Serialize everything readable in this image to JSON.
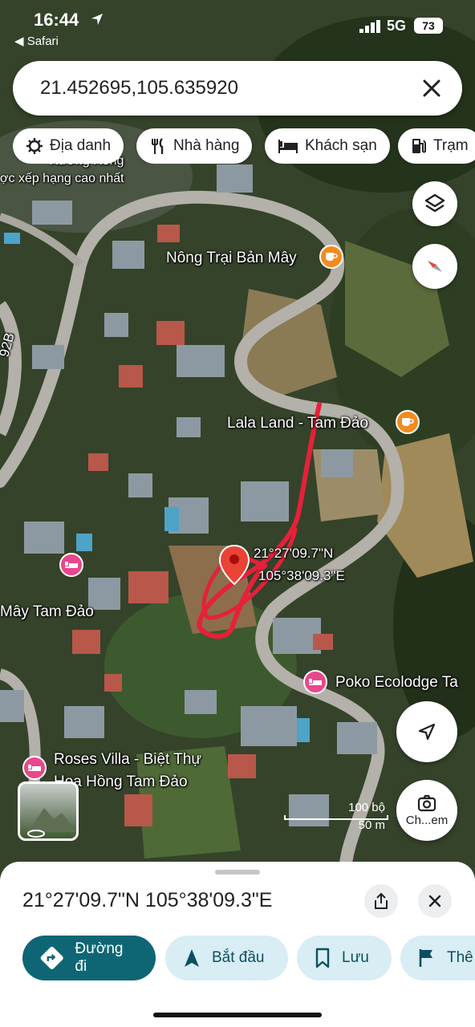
{
  "status_bar": {
    "time": "16:44",
    "back_label": "◀ Safari",
    "network": "5G",
    "battery": "73"
  },
  "search": {
    "value": "21.452695,105.635920"
  },
  "chips": [
    {
      "label": "Địa danh",
      "icon": "landmark-icon"
    },
    {
      "label": "Nhà hàng",
      "icon": "fork-knife-icon"
    },
    {
      "label": "Khách sạn",
      "icon": "bed-icon"
    },
    {
      "label": "Trạm",
      "icon": "gas-station-icon"
    }
  ],
  "map": {
    "labels": {
      "top_cut": "ợc xếp hạng cao nhất",
      "top_cut2": "Xương Rồng",
      "road": "92B",
      "nong_trai": "Nông Trại Bản Mây",
      "lala": "Lala Land - Tam Đảo",
      "pin_lat": "21°27'09.7\"N",
      "pin_lng": "105°38'09.3\"E",
      "may_tam_dao": "Mây Tam Đảo",
      "poko": "Poko Ecolodge Ta",
      "roses_1": "Roses Villa - Biệt Thự",
      "roses_2": "Hoa Hồng Tam Đảo"
    },
    "scale": {
      "imperial": "100 bộ",
      "metric": "50 m"
    },
    "contribute_label": "Ch...em",
    "colors": {
      "pin": "#ea4335",
      "marker_scribble": "#e5213a",
      "cafe_pin": "#f28b20",
      "hotel_pin": "#e8478b"
    }
  },
  "sheet": {
    "coords": "21°27'09.7\"N 105°38'09.3\"E",
    "actions": [
      {
        "label": "Đường đi",
        "icon": "directions-icon"
      },
      {
        "label": "Bắt đầu",
        "icon": "navigation-arrow-icon"
      },
      {
        "label": "Lưu",
        "icon": "bookmark-icon"
      },
      {
        "label": "Thê",
        "icon": "flag-icon"
      }
    ]
  }
}
